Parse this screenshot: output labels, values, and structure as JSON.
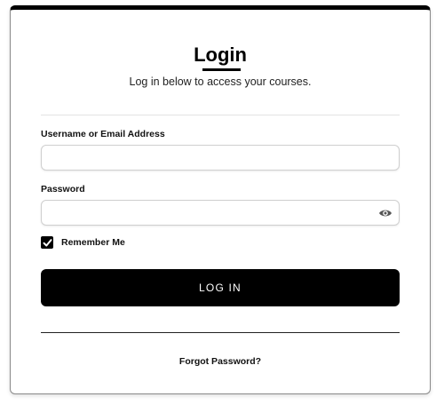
{
  "header": {
    "title": "Login",
    "subtitle": "Log in below to access your courses."
  },
  "form": {
    "username": {
      "label": "Username or Email Address",
      "value": "",
      "placeholder": ""
    },
    "password": {
      "label": "Password",
      "value": "",
      "placeholder": "",
      "toggle_icon": "eye-icon"
    },
    "remember": {
      "label": "Remember Me",
      "checked": true
    },
    "submit_label": "LOG IN"
  },
  "footer": {
    "forgot_label": "Forgot Password?"
  },
  "colors": {
    "accent": "#000000",
    "button_text": "#ffffff",
    "border": "#cfcfcf"
  }
}
